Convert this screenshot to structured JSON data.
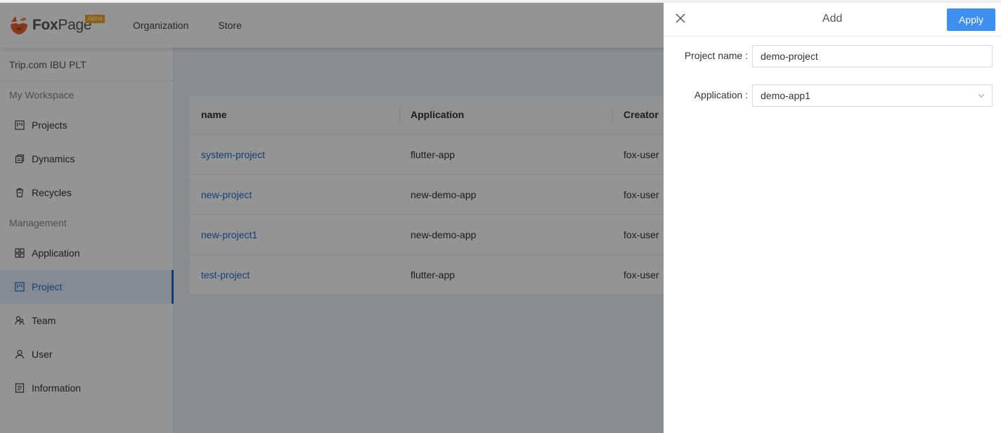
{
  "header": {
    "logo_text_bold": "Fox",
    "logo_text_rest": "Page",
    "logo_badge": "Alpha",
    "nav": [
      "Organization",
      "Store"
    ]
  },
  "sidebar": {
    "org_name": "Trip.com IBU PLT",
    "workspace_title": "My Workspace",
    "workspace_items": [
      {
        "label": "Projects",
        "icon": "project-icon"
      },
      {
        "label": "Dynamics",
        "icon": "dynamics-icon"
      },
      {
        "label": "Recycles",
        "icon": "recycle-bin-icon"
      }
    ],
    "management_title": "Management",
    "management_items": [
      {
        "label": "Application",
        "icon": "application-icon"
      },
      {
        "label": "Project",
        "icon": "project-icon",
        "active": true
      },
      {
        "label": "Team",
        "icon": "team-icon"
      },
      {
        "label": "User",
        "icon": "user-icon"
      },
      {
        "label": "Information",
        "icon": "information-icon"
      }
    ]
  },
  "table": {
    "headers": [
      "name",
      "Application",
      "Creator"
    ],
    "rows": [
      {
        "name": "system-project",
        "application": "flutter-app",
        "creator": "fox-user"
      },
      {
        "name": "new-project",
        "application": "new-demo-app",
        "creator": "fox-user"
      },
      {
        "name": "new-project1",
        "application": "new-demo-app",
        "creator": "fox-user"
      },
      {
        "name": "test-project",
        "application": "flutter-app",
        "creator": "fox-user"
      }
    ]
  },
  "drawer": {
    "title": "Add",
    "apply_label": "Apply",
    "project_name_label": "Project name :",
    "project_name_value": "demo-project",
    "application_label": "Application :",
    "application_value": "demo-app1"
  },
  "colors": {
    "primary": "#3d8ff0",
    "link": "#1f6fd0",
    "logo_orange": "#e8622a"
  }
}
